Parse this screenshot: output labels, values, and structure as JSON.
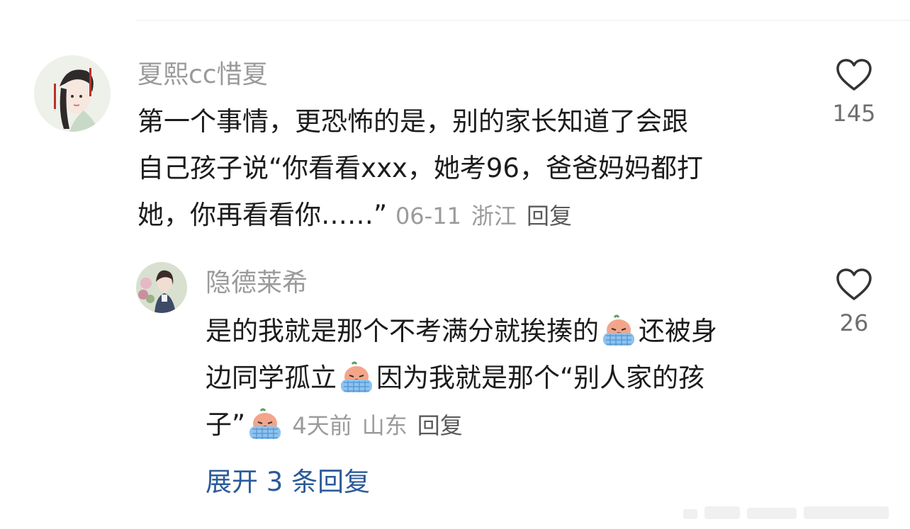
{
  "comment": {
    "username": "夏熙cc惜夏",
    "lines": [
      "第一个事情，更恐怖的是，别的家长知道了会跟",
      "自己孩子说“你看看xxx，她考96，爸爸妈妈都打",
      "她，你再看看你……”"
    ],
    "date": "06-11",
    "location": "浙江",
    "reply_label": "回复",
    "likes": "145"
  },
  "reply": {
    "username": "隐德莱希",
    "line1_a": "是的我就是那个不考满分就挨揍的",
    "line1_b": "还被身",
    "line2_a": "边同学孤立",
    "line2_b": "因为我就是那个“别人家的孩",
    "line3_a": "子”",
    "date": "4天前",
    "location": "山东",
    "reply_label": "回复",
    "likes": "26"
  },
  "expand_label": "展开 3 条回复",
  "icons": {
    "heart": "heart-outline-icon",
    "crying": "crying-face-emoji-icon"
  },
  "colors": {
    "username": "#9a9a9a",
    "text": "#1c1c1c",
    "meta": "#9b9b9b",
    "link": "#2b5a9a"
  }
}
